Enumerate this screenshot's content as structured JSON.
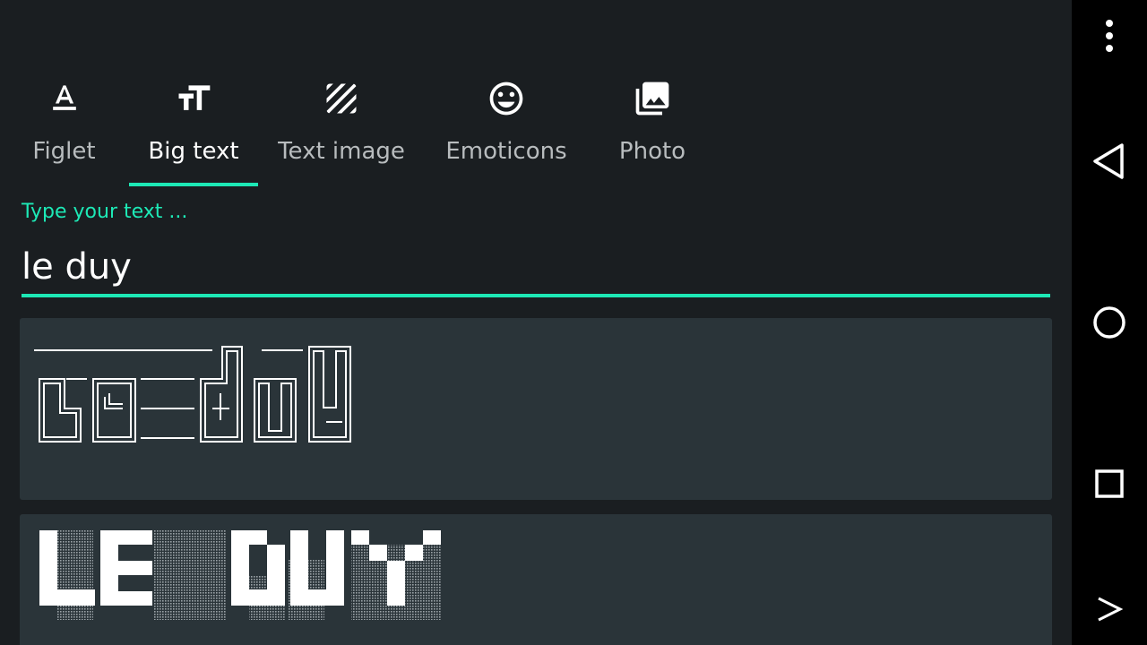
{
  "tabs": [
    {
      "label": "Figlet",
      "icon": "text-format-icon",
      "active": false
    },
    {
      "label": "Big text",
      "icon": "text-size-icon",
      "active": true
    },
    {
      "label": "Text image",
      "icon": "texture-icon",
      "active": false
    },
    {
      "label": "Emoticons",
      "icon": "smiley-icon",
      "active": false
    },
    {
      "label": "Photo",
      "icon": "photo-library-icon",
      "active": false
    }
  ],
  "input": {
    "hint": "Type your text ...",
    "value": "le duy"
  },
  "results": [
    {
      "style": "double-line box drawing",
      "art_text": "le duy"
    },
    {
      "style": "block pixel",
      "art_text": "LE DUY"
    }
  ],
  "colors": {
    "accent": "#1de9b6",
    "background": "#1a1e21",
    "card": "#2a3439",
    "navbar": "#000000"
  },
  "navbar": {
    "buttons": [
      "more-vert-icon",
      "back-icon",
      "home-icon",
      "recents-icon",
      "next-icon"
    ]
  }
}
